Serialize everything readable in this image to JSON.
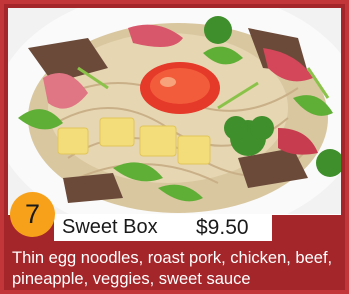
{
  "menu_item": {
    "number": "7",
    "name": "Sweet Box",
    "price": "$9.50",
    "description": "Thin egg noodles, roast pork, chicken, beef, pineapple, veggies, sweet sauce"
  },
  "colors": {
    "card_background": "#a5262a",
    "card_border": "#c2363a",
    "number_badge": "#f7a11a",
    "title_bar": "#ffffff",
    "description_text": "#ffffff"
  }
}
